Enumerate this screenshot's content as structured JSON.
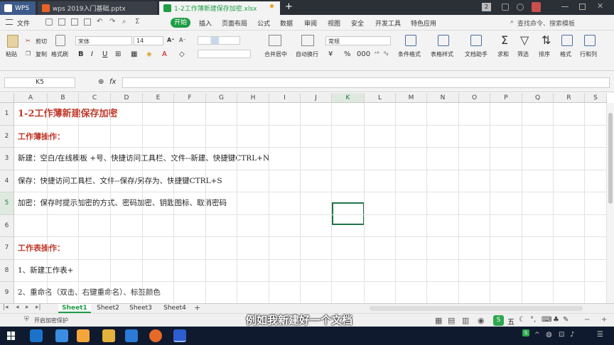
{
  "tabs": {
    "app": "WPS",
    "pptx": "wps 2019入门基础.pptx",
    "xlsx": "1-2工作薄新建保存加密.xlsx",
    "counter": "2"
  },
  "ribbon": {
    "file": "文件",
    "start": "开始",
    "tabs": [
      "插入",
      "页面布局",
      "公式",
      "数据",
      "审阅",
      "视图",
      "安全",
      "开发工具",
      "特色应用"
    ],
    "search": "查找命令、搜索模板"
  },
  "toolbar": {
    "paste": "粘贴",
    "cut": "剪切",
    "copy": "复制",
    "format_painter": "格式刷",
    "font": "宋体",
    "size": "14",
    "merge": "合并居中",
    "wrap": "自动换行",
    "numfmt": "常规",
    "cond_format": "条件格式",
    "table_style": "表格样式",
    "doc_helper": "文档助手",
    "sum": "求和",
    "filter": "筛选",
    "sort": "排序",
    "format": "格式",
    "rowcol": "行和列"
  },
  "formula_bar": {
    "cell_ref": "K5",
    "fx": "fx",
    "content": ""
  },
  "grid": {
    "columns": [
      "A",
      "B",
      "C",
      "D",
      "E",
      "F",
      "G",
      "H",
      "I",
      "J",
      "K",
      "L",
      "M",
      "N",
      "O",
      "P",
      "Q",
      "R",
      "S"
    ],
    "rows": [
      "1",
      "2",
      "3",
      "4",
      "5",
      "6",
      "7",
      "8"
    ],
    "cells": [
      {
        "row": "1",
        "text": "1-2工作薄新建保存加密",
        "style": "title"
      },
      {
        "row": "2",
        "text": "工作薄操作：",
        "style": "heading"
      },
      {
        "row": "3",
        "text": "新建：空白/在线模板  +号、快捷访问工具栏、文件--新建、快捷键CTRL+N",
        "style": "normal"
      },
      {
        "row": "4",
        "text": "保存：快捷访问工具栏、文件--保存/另存为、快捷键CTRL+S",
        "style": "normal"
      },
      {
        "row": "5",
        "text": "加密：保存时提示加密的方式、密码加密、钥匙图标、取消密码",
        "style": "normal"
      },
      {
        "row": "6",
        "text": "",
        "style": "normal"
      },
      {
        "row": "7",
        "text": "工作表操作：",
        "style": "heading"
      },
      {
        "row": "8",
        "text": "1、新建工作表+",
        "style": "normal"
      }
    ],
    "cut_row_text": "2、重命名（双击、右键重命名）、标签颜色"
  },
  "sheets": [
    "Sheet1",
    "Sheet2",
    "Sheet3",
    "Sheet4"
  ],
  "status": {
    "protect": "开启加密保护",
    "ime": "五"
  },
  "subtitle": "例如我新建好一个文档",
  "colors": {
    "accent_green": "#1e9e46",
    "title_red": "#c0392b",
    "selection": "#217346"
  }
}
